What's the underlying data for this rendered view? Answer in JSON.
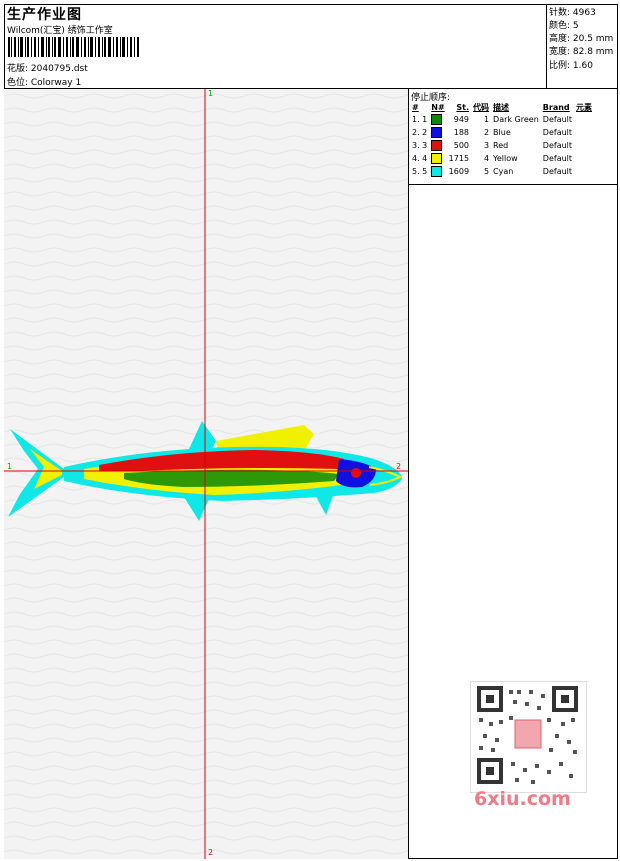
{
  "header": {
    "title": "生产作业图",
    "company": "Wilcom(汇宝) 绣饰工作室",
    "design_label": "花版: 2040795.dst",
    "colorway_label": "色位:  Colorway 1"
  },
  "stats": {
    "stitches": "针数: 4963",
    "colors": "颜色: 5",
    "height": "高度: 20.5 mm",
    "width": "宽度: 82.8 mm",
    "ratio": "比例: 1.60"
  },
  "canvas": {
    "axis_top": "1",
    "axis_bottom": "2",
    "axis_left": "1",
    "axis_right": "2"
  },
  "stop_sequence": {
    "title": "停止顺序:",
    "headers": [
      "#",
      "N#",
      "St.",
      "代码",
      "描述",
      "Brand",
      "元素"
    ],
    "rows": [
      {
        "idx": "1. 1",
        "color": "#0a8a0a",
        "st": "949",
        "code": "1",
        "desc": "Dark Green",
        "brand": "Default"
      },
      {
        "idx": "2. 2",
        "color": "#1010e0",
        "st": "188",
        "code": "2",
        "desc": "Blue",
        "brand": "Default"
      },
      {
        "idx": "3. 3",
        "color": "#e01010",
        "st": "500",
        "code": "3",
        "desc": "Red",
        "brand": "Default"
      },
      {
        "idx": "4. 4",
        "color": "#f0f000",
        "st": "1715",
        "code": "4",
        "desc": "Yellow",
        "brand": "Default"
      },
      {
        "idx": "5. 5",
        "color": "#10e8e8",
        "st": "1609",
        "code": "5",
        "desc": "Cyan",
        "brand": "Default"
      }
    ]
  },
  "watermark": "6xiu.com"
}
